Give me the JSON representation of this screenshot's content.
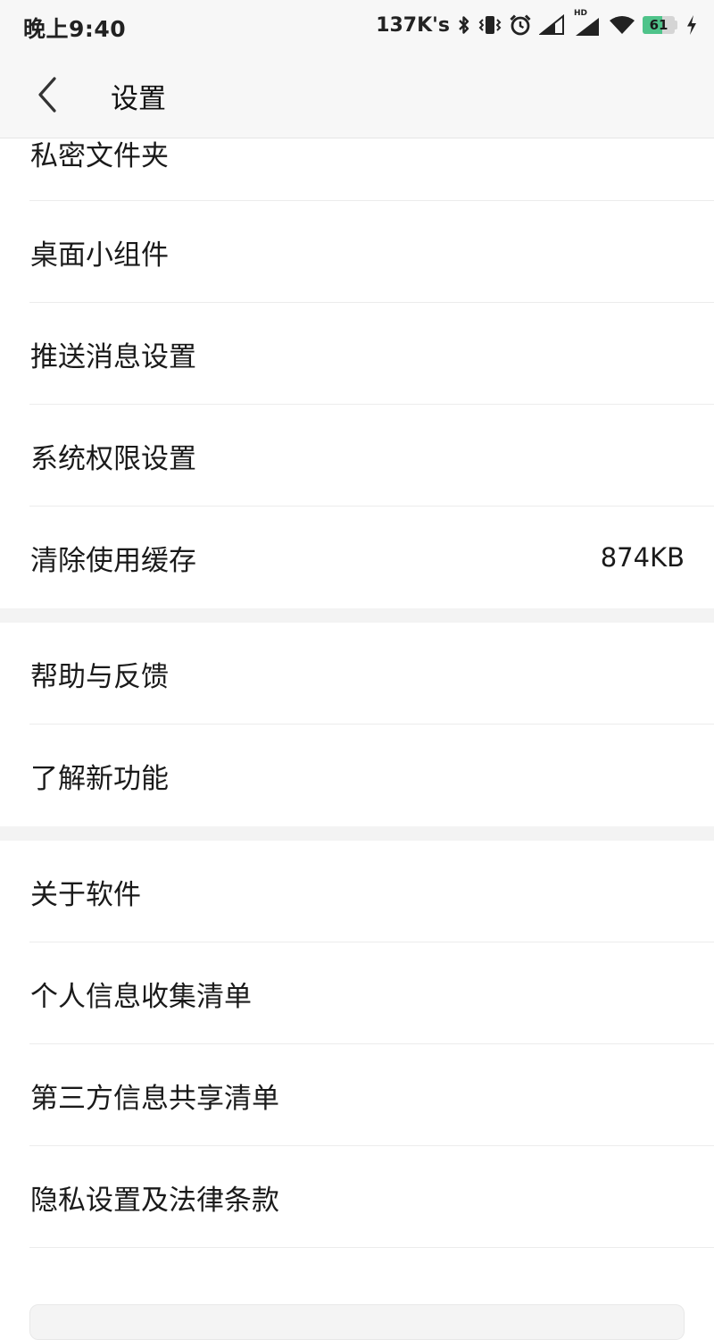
{
  "status_bar": {
    "time": "晚上9:40",
    "net_speed": "137K's",
    "battery_percent": 61,
    "battery_label": "61",
    "hd_label": "HD",
    "icons": [
      "bluetooth-icon",
      "vibrate-icon",
      "alarm-icon",
      "signal-icon",
      "signal-hd-icon",
      "wifi-icon",
      "battery-icon",
      "charging-icon"
    ],
    "battery_color": "#4fc38a"
  },
  "nav": {
    "back_icon": "chevron-left-icon",
    "title": "设置"
  },
  "settings": {
    "group1": [
      {
        "label": "私密文件夹"
      },
      {
        "label": "桌面小组件"
      },
      {
        "label": "推送消息设置"
      },
      {
        "label": "系统权限设置"
      },
      {
        "label": "清除使用缓存",
        "value": "874KB"
      }
    ],
    "group2": [
      {
        "label": "帮助与反馈"
      },
      {
        "label": "了解新功能"
      }
    ],
    "group3": [
      {
        "label": "关于软件"
      },
      {
        "label": "个人信息收集清单"
      },
      {
        "label": "第三方信息共享清单"
      },
      {
        "label": "隐私设置及法律条款"
      }
    ]
  },
  "colors": {
    "header_bg": "#f7f7f7",
    "divider": "#ececec",
    "section_gap": "#f3f3f3",
    "text": "#1a1a1a"
  }
}
